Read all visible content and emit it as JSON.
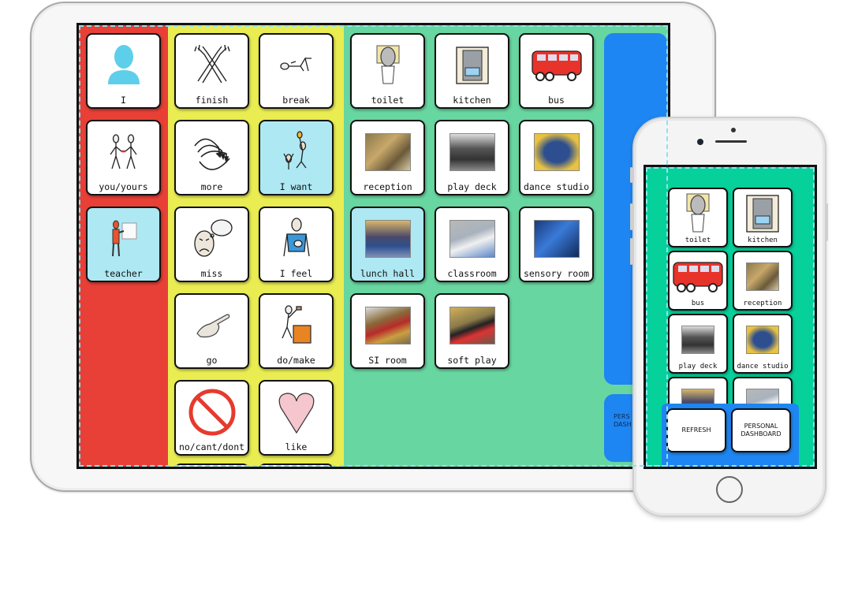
{
  "ipad": {
    "core_column": [
      {
        "label": "I",
        "icon": "person-silhouette-icon",
        "highlighted": false
      },
      {
        "label": "you/yours",
        "icon": "two-people-icon",
        "highlighted": false
      },
      {
        "label": "teacher",
        "icon": "teacher-board-icon",
        "highlighted": true
      }
    ],
    "verb_columns": [
      {
        "label": "finish",
        "icon": "crossed-arms-icon",
        "highlighted": false
      },
      {
        "label": "break",
        "icon": "reclining-person-icon",
        "highlighted": false
      },
      {
        "label": "more",
        "icon": "curved-arrows-icon",
        "highlighted": false
      },
      {
        "label": "I want",
        "icon": "reaching-people-icon",
        "highlighted": true
      },
      {
        "label": "miss",
        "icon": "sad-face-thought-icon",
        "highlighted": false
      },
      {
        "label": "I feel",
        "icon": "hand-on-chest-icon",
        "highlighted": false
      },
      {
        "label": "go",
        "icon": "pointing-hand-icon",
        "highlighted": false
      },
      {
        "label": "do/make",
        "icon": "person-hammering-icon",
        "highlighted": false
      },
      {
        "label": "no/cant/dont",
        "icon": "prohibited-icon",
        "highlighted": false
      },
      {
        "label": "like",
        "icon": "heart-icon",
        "highlighted": false
      }
    ],
    "places": [
      {
        "label": "toilet",
        "icon": "toilet-icon",
        "highlighted": false
      },
      {
        "label": "kitchen",
        "icon": "cooker-icon",
        "highlighted": false
      },
      {
        "label": "bus",
        "icon": "bus-icon",
        "highlighted": false
      },
      {
        "label": "reception",
        "icon": "reception-photo",
        "highlighted": false
      },
      {
        "label": "play deck",
        "icon": "play-deck-photo",
        "highlighted": false
      },
      {
        "label": "dance studio",
        "icon": "dance-studio-photo",
        "highlighted": false
      },
      {
        "label": "lunch hall",
        "icon": "lunch-hall-photo",
        "highlighted": true
      },
      {
        "label": "classroom",
        "icon": "classroom-photo",
        "highlighted": false
      },
      {
        "label": "sensory room",
        "icon": "sensory-room-photo",
        "highlighted": false
      },
      {
        "label": "SI room",
        "icon": "si-room-photo",
        "highlighted": false
      },
      {
        "label": "soft play",
        "icon": "soft-play-photo",
        "highlighted": false
      }
    ],
    "side_button_partial": "PERS\nDASH"
  },
  "iphone": {
    "tiles": [
      {
        "label": "toilet",
        "icon": "toilet-icon"
      },
      {
        "label": "kitchen",
        "icon": "cooker-icon"
      },
      {
        "label": "bus",
        "icon": "bus-icon"
      },
      {
        "label": "reception",
        "icon": "reception-photo"
      },
      {
        "label": "play deck",
        "icon": "play-deck-photo"
      },
      {
        "label": "dance studio",
        "icon": "dance-studio-photo"
      },
      {
        "label": "",
        "icon": "lunch-hall-photo"
      },
      {
        "label": "",
        "icon": "classroom-photo"
      }
    ],
    "buttons": {
      "refresh": "REFRESH",
      "personal_dashboard": "PERSONAL\nDASHBOARD"
    }
  },
  "colors": {
    "core": "#e84037",
    "verbs": "#eaed52",
    "places": "#68d6a0",
    "nav": "#1e86f2",
    "highlight": "#aee8f2",
    "phone_bg": "#06d19b"
  }
}
